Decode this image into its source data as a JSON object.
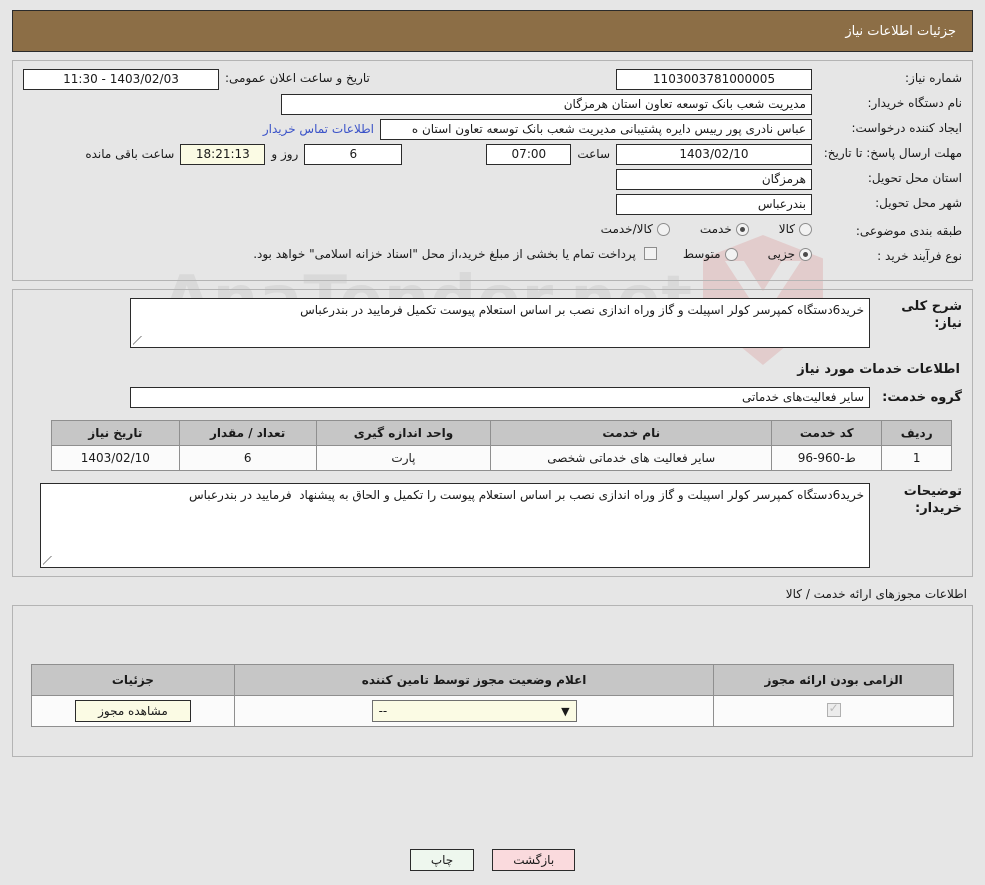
{
  "header": {
    "title": "جزئیات اطلاعات نیاز"
  },
  "watermark": {
    "text": "AnaTender.net"
  },
  "form": {
    "need_number_label": "شماره نیاز:",
    "need_number_value": "1103003781000005",
    "announce_label": "تاریخ و ساعت اعلان عمومی:",
    "announce_value": "1403/02/03 - 11:30",
    "buyer_org_label": "نام دستگاه خریدار:",
    "buyer_org_value": "مدیریت شعب بانک توسعه تعاون استان هرمزگان",
    "creator_label": "ایجاد کننده درخواست:",
    "creator_value": "عباس نادری پور رییس دایره پشتیبانی مدیریت شعب بانک توسعه تعاون استان ه",
    "contact_link": "اطلاعات تماس خریدار",
    "deadline_label": "مهلت ارسال پاسخ: تا تاریخ:",
    "deadline_date": "1403/02/10",
    "time_label": "ساعت",
    "deadline_time": "07:00",
    "days_value": "6",
    "days_label": "روز و",
    "hours_value": "18:21:13",
    "remaining_label": "ساعت باقی مانده",
    "province_label": "استان محل تحویل:",
    "province_value": "هرمزگان",
    "city_label": "شهر محل تحویل:",
    "city_value": "بندرعباس",
    "category_label": "طبقه بندی موضوعی:",
    "category_options": [
      {
        "label": "کالا",
        "selected": false
      },
      {
        "label": "خدمت",
        "selected": true
      },
      {
        "label": "کالا/خدمت",
        "selected": false
      }
    ],
    "process_label": "نوع فرآیند خرید :",
    "process_options": [
      {
        "label": "جزیی",
        "selected": true
      },
      {
        "label": "متوسط",
        "selected": false
      }
    ],
    "treasury_checked": false,
    "treasury_note": "پرداخت تمام یا بخشی از مبلغ خرید،از محل \"اسناد خزانه اسلامی\" خواهد بود."
  },
  "description": {
    "need_label": "شرح کلی نیاز:",
    "need_text": "خرید6دستگاه کمپرسر کولر اسپیلت و گاز وراه اندازی نصب بر اساس استعلام پیوست تکمیل فرمایید در بندرعباس",
    "services_title": "اطلاعات خدمات مورد نیاز",
    "service_group_label": "گروه خدمت:",
    "service_group_value": "سایر فعالیت‌های خدماتی"
  },
  "items_table": {
    "columns": [
      "ردیف",
      "کد خدمت",
      "نام خدمت",
      "واحد اندازه گیری",
      "تعداد / مقدار",
      "تاریخ نیاز"
    ],
    "rows": [
      [
        "1",
        "ط-960-96",
        "سایر فعالیت های خدماتی شخصی",
        "پارت",
        "6",
        "1403/02/10"
      ]
    ]
  },
  "buyer_comments": {
    "label": "توضیحات خریدار:",
    "text": "خرید6دستگاه کمپرسر کولر اسپیلت و گاز وراه اندازی نصب بر اساس استعلام پیوست را تکمیل و الحاق به پیشنهاد  فرمایید در بندرعباس"
  },
  "licenses": {
    "section_note": "اطلاعات مجوزهای ارائه خدمت / کالا",
    "columns": [
      "الزامی بودن ارائه مجوز",
      "اعلام وضعیت مجوز توسط تامین کننده",
      "جزئیات"
    ],
    "row": {
      "required_checked": true,
      "status_value": "--",
      "details_button": "مشاهده مجوز"
    }
  },
  "footer": {
    "print_label": "چاپ",
    "back_label": "بازگشت"
  },
  "colors": {
    "header_bg": "#8c6e46",
    "page_bg": "#e6e6e6",
    "link": "#3a52c8",
    "table_header_bg": "#c6c6c6",
    "yellow_field": "#fbfbe4",
    "back_button_bg": "#fadadd",
    "print_button_bg": "#eef7ee"
  }
}
